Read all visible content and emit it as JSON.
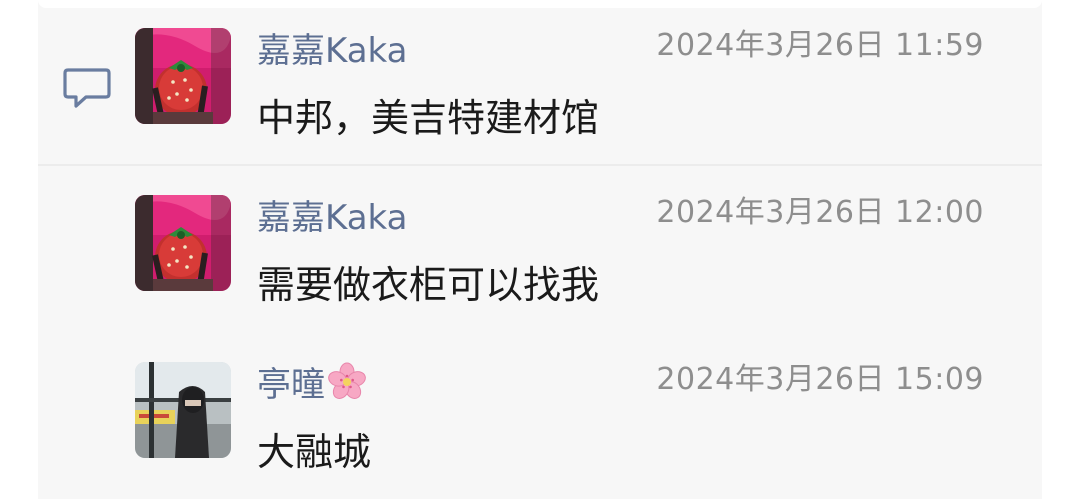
{
  "colors": {
    "name": "#5d6f92",
    "time": "#8e8e8e",
    "text": "#1a1a1a",
    "panel": "#f7f7f7"
  },
  "comment_icon": "comment-bubble-icon",
  "messages": [
    {
      "name": "嘉嘉Kaka",
      "time": "2024年3月26日 11:59",
      "text": "中邦，美吉特建材馆",
      "avatar": "strawberry-costume-avatar"
    },
    {
      "name": "嘉嘉Kaka",
      "time": "2024年3月26日 12:00",
      "text": "需要做衣柜可以找我",
      "avatar": "strawberry-costume-avatar"
    },
    {
      "name": "亭曈",
      "name_emoji": "cherry-blossom-icon",
      "time": "2024年3月26日 15:09",
      "text": "大融城",
      "avatar": "window-portrait-avatar"
    }
  ]
}
